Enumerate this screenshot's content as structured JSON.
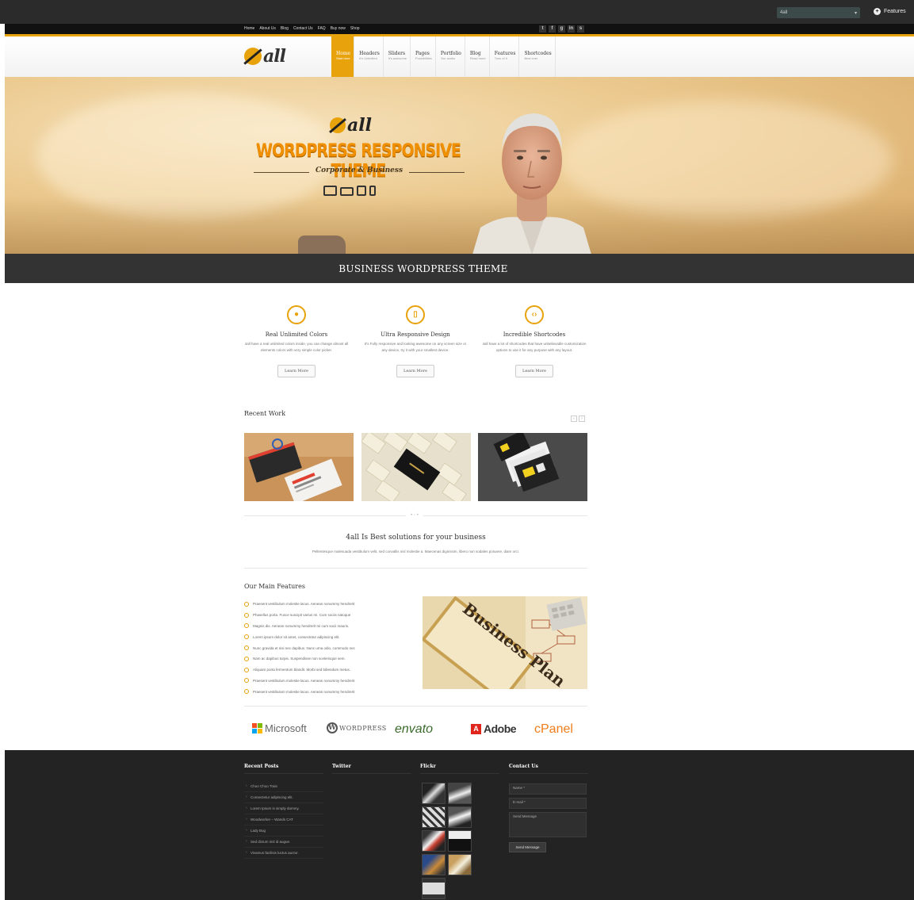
{
  "admin_bar": {
    "search_value": "4all",
    "search_caret": "▾",
    "features_icon": "plus-circle-icon",
    "features_label": "Features"
  },
  "topbar": {
    "menu": [
      "Home",
      "About Us",
      "Blog",
      "Contact Us",
      "FAQ",
      "Buy now",
      "Shop"
    ],
    "social": [
      {
        "icon": "twitter-icon",
        "glyph": "t"
      },
      {
        "icon": "facebook-icon",
        "glyph": "f"
      },
      {
        "icon": "google-plus-icon",
        "glyph": "g"
      },
      {
        "icon": "linkedin-icon",
        "glyph": "in"
      },
      {
        "icon": "skype-icon",
        "glyph": "s"
      }
    ]
  },
  "header": {
    "logo_text": "all",
    "nav": [
      {
        "title": "Home",
        "sub": "Start here",
        "active": true
      },
      {
        "title": "Headers",
        "sub": "It's Unlimited",
        "active": false
      },
      {
        "title": "Sliders",
        "sub": "It's awesome",
        "active": false
      },
      {
        "title": "Pages",
        "sub": "Possibilities",
        "active": false
      },
      {
        "title": "Portfolio",
        "sub": "Our works",
        "active": false
      },
      {
        "title": "Blog",
        "sub": "Read more",
        "active": false
      },
      {
        "title": "Features",
        "sub": "Tons of it",
        "active": false
      },
      {
        "title": "Shortcodes",
        "sub": "Best ever",
        "active": false
      }
    ]
  },
  "hero": {
    "logo_text": "all",
    "title": "WORDPRESS RESPONSIVE THEME",
    "subtitle": "Corporate & Business",
    "devices": [
      "desktop-icon",
      "laptop-icon",
      "tablet-icon",
      "phone-icon"
    ]
  },
  "band": {
    "text": "BUSINESS WORDPRESS THEME"
  },
  "features": [
    {
      "icon": "drop-icon",
      "glyph": "●",
      "title": "Real Unlimited Colors",
      "desc": "4all have a real unlimited colors inside, you can change almost all elements colors with very simple color picker.",
      "button": "Learn More"
    },
    {
      "icon": "mobile-icon",
      "glyph": "▯",
      "title": "Ultra Responsive Design",
      "desc": "It's Fully responsive and looking awesome on any screen size or any device, try it with your smallest device.",
      "button": "Learn More"
    },
    {
      "icon": "code-icon",
      "glyph": "‹›",
      "title": "Incredible Shortcodes",
      "desc": "4all have a lot of shortcodes that have unbelievable customization options to use it for any purpose with any layout.",
      "button": "Learn More"
    }
  ],
  "recent_work": {
    "title": "Recent Work",
    "prev": "‹",
    "next": "›"
  },
  "tagline": {
    "title": "4all Is Best solutions for your business",
    "text": "Pellentesque malesuada vestibulum velit, sed convallis nisl molestie a. Maecenas dignissim, libero non sodales posuere, diam orci."
  },
  "main_features": {
    "title": "Our Main Features",
    "items": [
      "Praesent vestibulum molestie lacus. Aenean nonummy hendrerit",
      "Phasellus porta. Fusce suscipit varius mi. Cum sociis natoque",
      "Magnis dis. Aenean nonummy hendrerit mi cum socii mauris.",
      "Lorem ipsum dolor sit amet, consectetur adipiscing elit.",
      "Nunc gravida et nisi nec dapibus. Nunc urna odio, commodo nec",
      "Nam ac dapibus turpis. Suspendisse non scelerisque sem.",
      "Aliquam porta fermentum blandit. Morbi sed bibendum metus.",
      "Praesent vestibulum molestie lacus. Aenean nonummy hendrerit",
      "Praesent vestibulum molestie lacus. Aenean nonummy hendrerit"
    ],
    "image_text": "Business Plan"
  },
  "clients": {
    "microsoft": "Microsoft",
    "wordpress": "WORDPRESS",
    "envato": "envato",
    "adobe": "Adobe",
    "cpanel": "cPanel"
  },
  "footer": {
    "recent_posts_title": "Recent Posts",
    "twitter_title": "Twitter",
    "flickr_title": "Flickr",
    "contact_title": "Contact Us",
    "posts": [
      "Choo Choo Train",
      "Consectetur adipiscing elit.",
      "Lorem Ipsum is simply dummy.",
      "Woodworker – Wands CAT",
      "Lady Bug",
      "Sed dictum nisl id augue.",
      "Vivamus facilisis luctus auctor."
    ],
    "contact_name_placeholder": "Name *",
    "contact_email_placeholder": "E-mail *",
    "contact_message_placeholder": "Send Message",
    "contact_send_button": "Send Message"
  },
  "colors": {
    "accent": "#e8a20c",
    "dark": "#232323",
    "band": "#333333"
  }
}
